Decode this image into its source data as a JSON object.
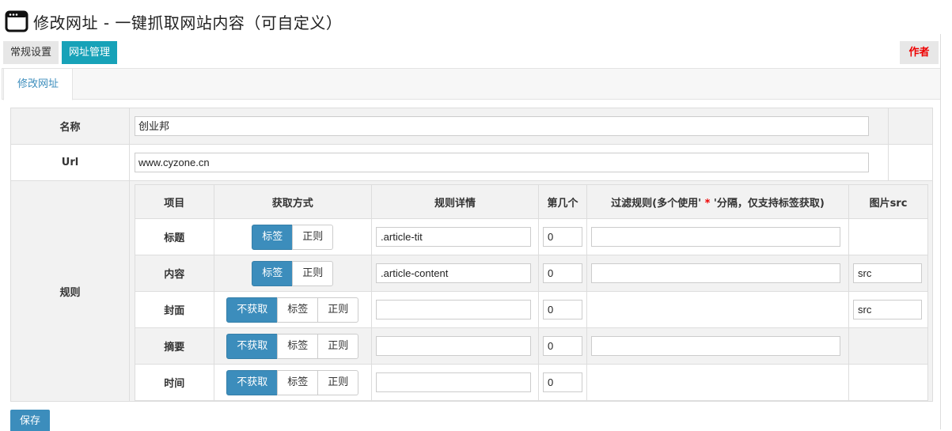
{
  "page": {
    "title": "修改网址 - 一键抓取网站内容（可自定义）",
    "window_icon": "browser-window-icon"
  },
  "top_tabs": [
    {
      "label": "常规设置"
    },
    {
      "label": "网址管理"
    }
  ],
  "author_button": {
    "label": "作者"
  },
  "sub_tab": {
    "label": "修改网址"
  },
  "form": {
    "name": {
      "label": "名称",
      "value": "创业邦"
    },
    "url": {
      "label": "Url",
      "value": "www.cyzone.cn"
    },
    "rules": {
      "label": "规则"
    }
  },
  "rules_table": {
    "headers": {
      "item": "项目",
      "mode": "获取方式",
      "detail": "规则详情",
      "nth": "第几个",
      "filter_prefix": "过滤规则(多个使用' ",
      "filter_star": "*",
      "filter_suffix": " '分隔，仅支持标签获取)",
      "src": "图片src"
    },
    "mode_labels": {
      "none": "不获取",
      "tag": "标签",
      "regex": "正则"
    },
    "rows": [
      {
        "item": "标题",
        "mode": "标签",
        "detail": ".article-tit",
        "nth": "0",
        "filter": "",
        "src": ""
      },
      {
        "item": "内容",
        "mode": "标签",
        "detail": ".article-content",
        "nth": "0",
        "filter": "",
        "src": "src"
      },
      {
        "item": "封面",
        "mode": "不获取",
        "detail": "",
        "nth": "0",
        "src": "src"
      },
      {
        "item": "摘要",
        "mode": "不获取",
        "detail": "",
        "nth": "0",
        "filter": ""
      },
      {
        "item": "时间",
        "mode": "不获取",
        "detail": "",
        "nth": "0"
      }
    ]
  },
  "save_button": {
    "label": "保存"
  },
  "colors": {
    "primary": "#3c8dbc",
    "teal_tab": "#17a2b8",
    "author_red": "#ee0000",
    "tab_gray": "#e7e7e7"
  }
}
